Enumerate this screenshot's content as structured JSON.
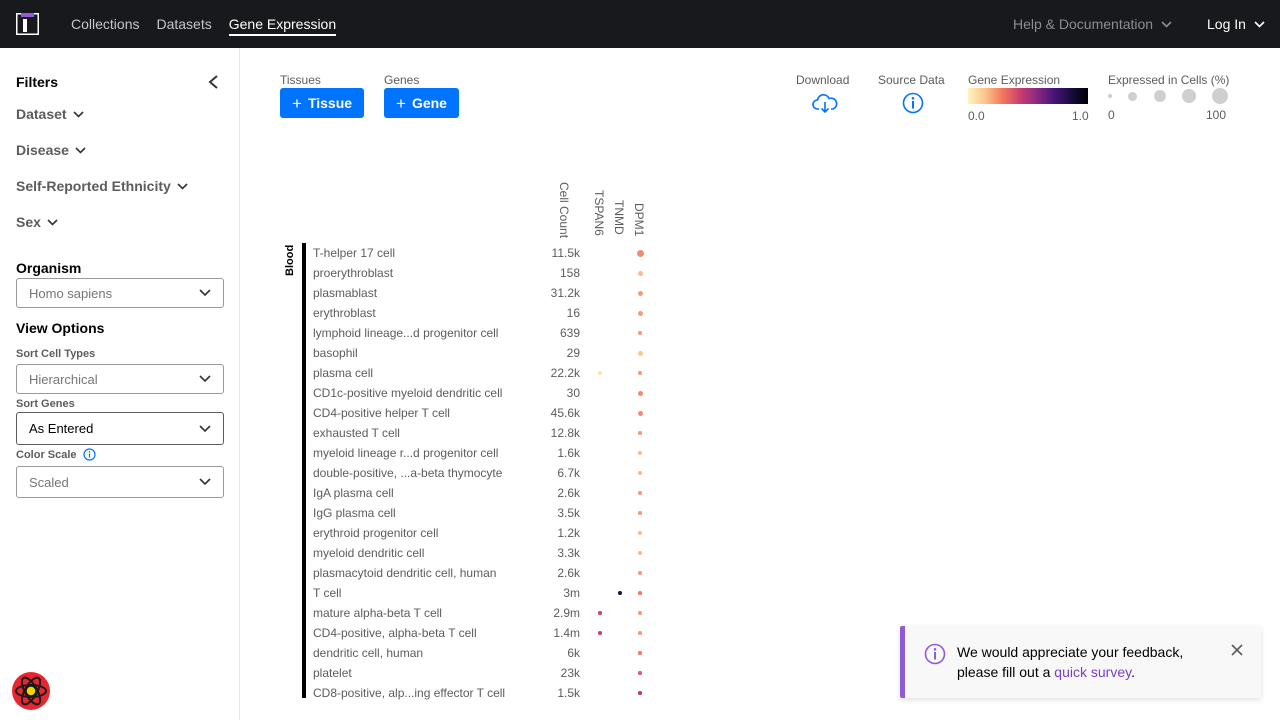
{
  "header": {
    "nav": [
      "Collections",
      "Datasets",
      "Gene Expression"
    ],
    "help": "Help & Documentation",
    "login": "Log In"
  },
  "sidebar": {
    "title": "Filters",
    "filters": [
      "Dataset",
      "Disease",
      "Self-Reported Ethnicity",
      "Sex"
    ],
    "organism_title": "Organism",
    "organism_value": "Homo sapiens",
    "view_options_title": "View Options",
    "sort_cell_types_label": "Sort Cell Types",
    "sort_cell_types_value": "Hierarchical",
    "sort_genes_label": "Sort Genes",
    "sort_genes_value": "As Entered",
    "color_scale_label": "Color Scale",
    "color_scale_value": "Scaled"
  },
  "toolbar": {
    "tissues_label": "Tissues",
    "tissue_button": "Tissue",
    "genes_label": "Genes",
    "gene_button": "Gene",
    "download_label": "Download",
    "source_label": "Source Data",
    "gene_expression_label": "Gene Expression",
    "ge_min": "0.0",
    "ge_max": "1.0",
    "expressed_label": "Expressed in Cells (%)",
    "ex_min": "0",
    "ex_max": "100"
  },
  "grid": {
    "cell_count_header": "Cell Count",
    "genes": [
      "TSPAN6",
      "TNMD",
      "DPM1"
    ],
    "tissue": "Blood",
    "rows": [
      {
        "name": "T-helper 17 cell",
        "count": "11.5k"
      },
      {
        "name": "proerythroblast",
        "count": "158"
      },
      {
        "name": "plasmablast",
        "count": "31.2k"
      },
      {
        "name": "erythroblast",
        "count": "16"
      },
      {
        "name": "lymphoid lineage...d progenitor cell",
        "count": "639"
      },
      {
        "name": "basophil",
        "count": "29"
      },
      {
        "name": "plasma cell",
        "count": "22.2k"
      },
      {
        "name": "CD1c-positive myeloid dendritic cell",
        "count": "30"
      },
      {
        "name": "CD4-positive helper T cell",
        "count": "45.6k"
      },
      {
        "name": "exhausted T cell",
        "count": "12.8k"
      },
      {
        "name": "myeloid lineage r...d progenitor cell",
        "count": "1.6k"
      },
      {
        "name": "double-positive, ...a-beta thymocyte",
        "count": "6.7k"
      },
      {
        "name": "IgA plasma cell",
        "count": "2.6k"
      },
      {
        "name": "IgG plasma cell",
        "count": "3.5k"
      },
      {
        "name": "erythroid progenitor cell",
        "count": "1.2k"
      },
      {
        "name": "myeloid dendritic cell",
        "count": "3.3k"
      },
      {
        "name": "plasmacytoid dendritic cell, human",
        "count": "2.6k"
      },
      {
        "name": "T cell",
        "count": "3m"
      },
      {
        "name": "mature alpha-beta T cell",
        "count": "2.9m"
      },
      {
        "name": "CD4-positive, alpha-beta T cell",
        "count": "1.4m"
      },
      {
        "name": "dendritic cell, human",
        "count": "6k"
      },
      {
        "name": "platelet",
        "count": "23k"
      },
      {
        "name": "CD8-positive, alp...ing effector T cell",
        "count": "1.5k"
      }
    ],
    "dots": [
      {
        "row": 0,
        "gene": 2,
        "color": "#f58b6e",
        "size": "large"
      },
      {
        "row": 1,
        "gene": 2,
        "color": "#fcb98c",
        "size": "small"
      },
      {
        "row": 2,
        "gene": 2,
        "color": "#f59a74",
        "size": "small"
      },
      {
        "row": 3,
        "gene": 2,
        "color": "#f59a74",
        "size": "small"
      },
      {
        "row": 4,
        "gene": 2,
        "color": "#f59a74",
        "size": "tiny"
      },
      {
        "row": 5,
        "gene": 2,
        "color": "#fcc58c",
        "size": "small"
      },
      {
        "row": 6,
        "gene": 0,
        "color": "#fce6a4",
        "size": "tiny"
      },
      {
        "row": 6,
        "gene": 2,
        "color": "#f59a74",
        "size": "tiny"
      },
      {
        "row": 7,
        "gene": 2,
        "color": "#f58b6e",
        "size": "small"
      },
      {
        "row": 8,
        "gene": 2,
        "color": "#f58b6e",
        "size": "small"
      },
      {
        "row": 9,
        "gene": 2,
        "color": "#f59a74",
        "size": "tiny"
      },
      {
        "row": 10,
        "gene": 2,
        "color": "#fcb98c",
        "size": "tiny"
      },
      {
        "row": 11,
        "gene": 2,
        "color": "#fcb98c",
        "size": "tiny"
      },
      {
        "row": 12,
        "gene": 2,
        "color": "#f59a74",
        "size": "tiny"
      },
      {
        "row": 13,
        "gene": 2,
        "color": "#f59a74",
        "size": "tiny"
      },
      {
        "row": 14,
        "gene": 2,
        "color": "#fcb98c",
        "size": "tiny"
      },
      {
        "row": 15,
        "gene": 2,
        "color": "#fcb98c",
        "size": "tiny"
      },
      {
        "row": 16,
        "gene": 2,
        "color": "#f59a74",
        "size": "tiny"
      },
      {
        "row": 17,
        "gene": 1,
        "color": "#2a0f52",
        "size": "tiny"
      },
      {
        "row": 17,
        "gene": 2,
        "color": "#f5785c",
        "size": "tiny"
      },
      {
        "row": 18,
        "gene": 0,
        "color": "#d43e6b",
        "size": "tiny"
      },
      {
        "row": 18,
        "gene": 2,
        "color": "#f59a74",
        "size": "tiny"
      },
      {
        "row": 19,
        "gene": 0,
        "color": "#d43e6b",
        "size": "tiny"
      },
      {
        "row": 19,
        "gene": 2,
        "color": "#f59a74",
        "size": "tiny"
      },
      {
        "row": 20,
        "gene": 2,
        "color": "#f5785c",
        "size": "tiny"
      },
      {
        "row": 21,
        "gene": 2,
        "color": "#e05a6c",
        "size": "tiny"
      },
      {
        "row": 22,
        "gene": 2,
        "color": "#c0396e",
        "size": "tiny"
      }
    ]
  },
  "toast": {
    "text_before": "We would appreciate your feedback, please fill out a ",
    "link": "quick survey",
    "text_after": "."
  },
  "colors": {
    "primary": "#0073ff",
    "header_bg": "#17191c",
    "toast_accent": "#8f5cd5"
  }
}
